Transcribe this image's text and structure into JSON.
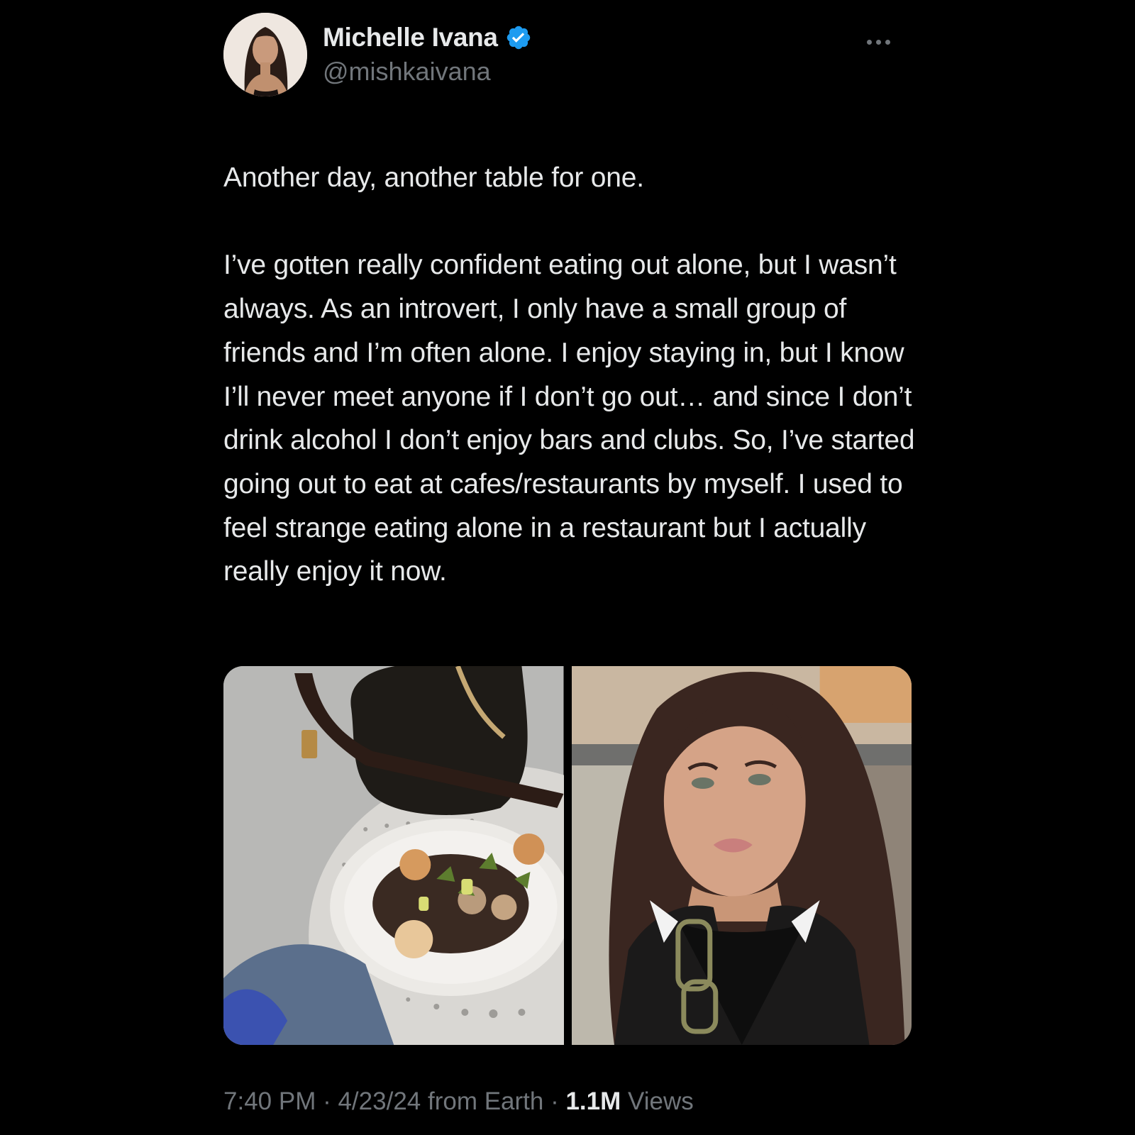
{
  "author": {
    "display_name": "Michelle Ivana",
    "handle": "@mishkaivana",
    "verified": true
  },
  "tweet": {
    "text": "Another day, another table for one.\n\nI’ve gotten really confident eating out alone, but I wasn’t always. As an introvert, I only have a small group of friends and I’m often alone. I enjoy staying in, but I know I’ll never meet anyone if I don’t go out… and since I don’t drink alcohol I don’t enjoy bars and clubs. So, I’ve started going out to eat at cafes/restaurants by myself. I used to feel strange eating alone in a restaurant but I actually really enjoy it now."
  },
  "media": [
    {
      "icon": "food-table-photo"
    },
    {
      "icon": "selfie-photo"
    }
  ],
  "meta": {
    "time": "7:40 PM",
    "separator": " · ",
    "date": "4/23/24",
    "source": " from Earth",
    "views_count": "1.1M",
    "views_label": " Views"
  },
  "colors": {
    "background": "#000000",
    "text_primary": "#e7e9ea",
    "text_secondary": "#71767b",
    "verified_blue": "#1d9bf0"
  }
}
